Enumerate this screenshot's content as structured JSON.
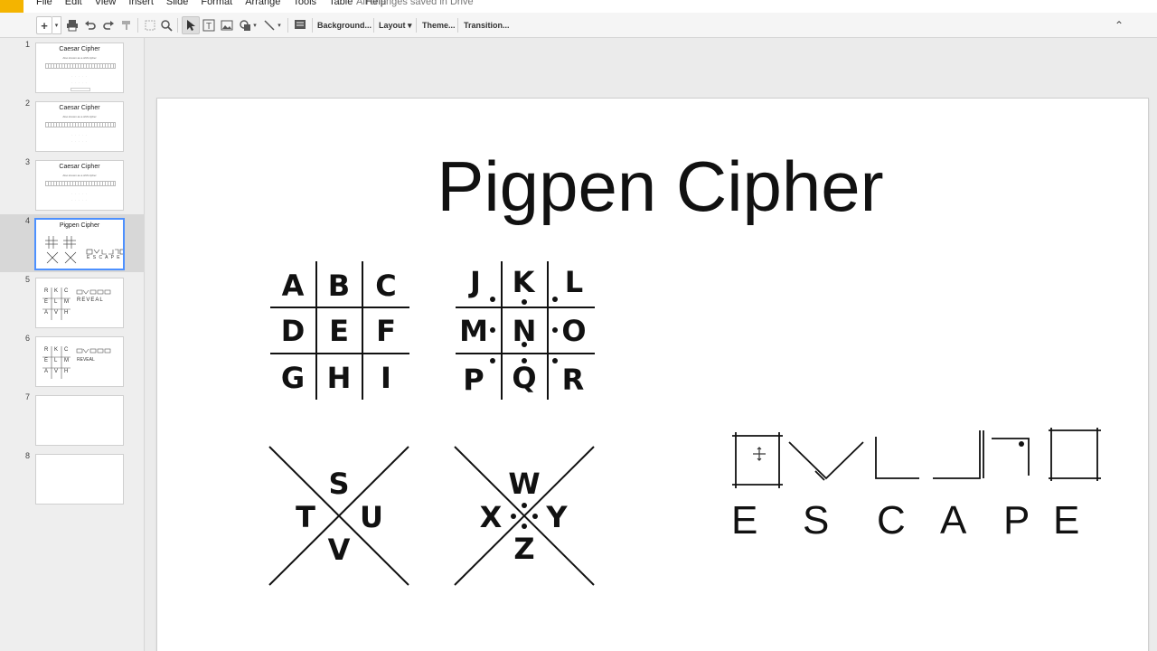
{
  "menu": {
    "items": [
      "File",
      "Edit",
      "View",
      "Insert",
      "Slide",
      "Format",
      "Arrange",
      "Tools",
      "Table",
      "Help"
    ],
    "status": "All changes saved in Drive"
  },
  "toolbar": {
    "new_slide": "+",
    "new_slide_dropdown": "▾",
    "background": "Background...",
    "layout": "Layout ▾",
    "theme": "Theme...",
    "transition": "Transition...",
    "collapse": "⌃"
  },
  "filmstrip": {
    "slides": [
      {
        "num": "1",
        "title": "Caesar Cipher",
        "sub": "Also known as a shift cipher"
      },
      {
        "num": "2",
        "title": "Caesar Cipher",
        "sub": "Also known as a shift cipher"
      },
      {
        "num": "3",
        "title": "Caesar Cipher",
        "sub": "Also known as a shift cipher"
      },
      {
        "num": "4",
        "title": "Pigpen Cipher",
        "word": "E S C A P E"
      },
      {
        "num": "5",
        "grid": [
          "R",
          "K",
          "C",
          "E",
          "L",
          "M",
          "A",
          "V",
          "H"
        ],
        "word": "REVEAL"
      },
      {
        "num": "6",
        "grid": [
          "R",
          "K",
          "C",
          "E",
          "L",
          "M",
          "A",
          "V",
          "H"
        ],
        "word": "REVEAL"
      },
      {
        "num": "7"
      },
      {
        "num": "8"
      }
    ]
  },
  "slide": {
    "title": "Pigpen Cipher",
    "grid1": [
      "A",
      "B",
      "C",
      "D",
      "E",
      "F",
      "G",
      "H",
      "I"
    ],
    "grid2": [
      "J",
      "K",
      "L",
      "M",
      "N",
      "O",
      "P",
      "Q",
      "R"
    ],
    "x1": {
      "top": "S",
      "left": "T",
      "right": "U",
      "bottom": "V"
    },
    "x2": {
      "top": "W",
      "left": "X",
      "right": "Y",
      "bottom": "Z"
    },
    "word": [
      "E",
      "S",
      "C",
      "A",
      "P",
      "E"
    ]
  }
}
